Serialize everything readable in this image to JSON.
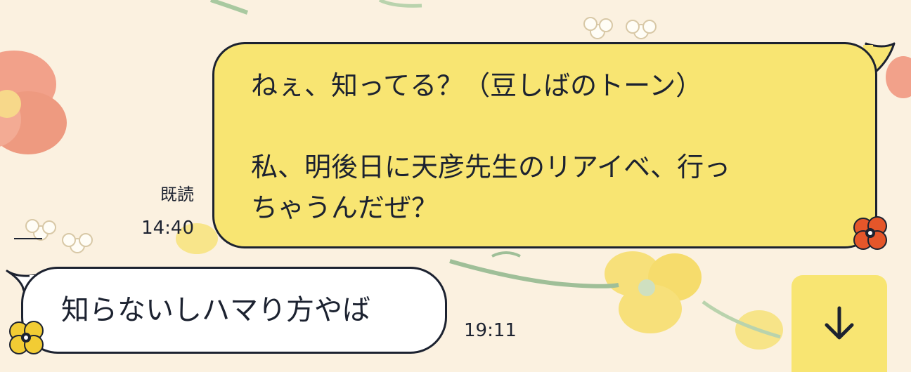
{
  "messages": {
    "outgoing": {
      "lines": [
        "ねぇ、知ってる？（豆しばのトーン）",
        "私、明後日に天彦先生のリアイベ、行っ",
        "ちゃうんだぜ？"
      ],
      "read_label": "既読",
      "time": "14:40"
    },
    "incoming": {
      "text": "知らないしハマり方やば",
      "time": "19:11"
    }
  },
  "controls": {
    "scroll_down_icon": "arrow-down-icon"
  },
  "colors": {
    "outgoing_bubble": "#f8e572",
    "incoming_bubble": "#ffffff",
    "outline": "#1c2230",
    "background": "#fbf1e0"
  }
}
